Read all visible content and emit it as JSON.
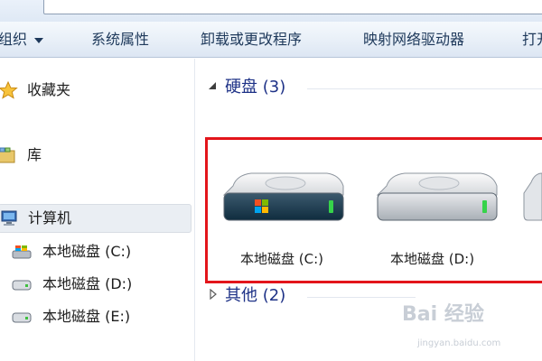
{
  "toolbar": {
    "organize": "组织",
    "system_properties": "系统属性",
    "uninstall": "卸载或更改程序",
    "map_drive": "映射网络驱动器",
    "open": "打开"
  },
  "sidebar": {
    "favorites": "收藏夹",
    "libraries": "库",
    "computer": "计算机",
    "drives": [
      "本地磁盘 (C:)",
      "本地磁盘 (D:)",
      "本地磁盘 (E:)"
    ]
  },
  "content": {
    "hard_disks_header": "硬盘 (3)",
    "other_header": "其他 (2)",
    "drives": [
      "本地磁盘 (C:)",
      "本地磁盘 (D:)"
    ]
  },
  "highlight_color": "#e3151b",
  "watermark": {
    "logo_text": "Bai 经验",
    "url": "jingyan.baidu.com"
  }
}
